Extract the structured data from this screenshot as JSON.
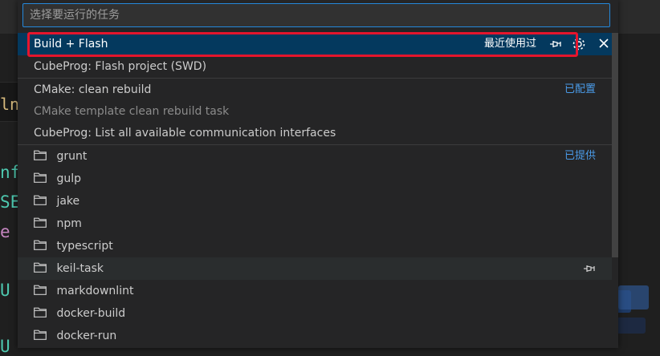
{
  "quick_pick": {
    "placeholder": "选择要运行的任务",
    "items": [
      {
        "label": "Build + Flash",
        "recent_label": "最近使用过"
      },
      {
        "label": "CubeProg: Flash project (SWD)"
      },
      {
        "label": "CMake: clean rebuild",
        "group_label": "已配置"
      },
      {
        "label": "CMake template clean rebuild task"
      },
      {
        "label": "CubeProg: List all available communication interfaces"
      },
      {
        "label": "grunt",
        "group_label": "已提供"
      },
      {
        "label": "gulp"
      },
      {
        "label": "jake"
      },
      {
        "label": "npm"
      },
      {
        "label": "typescript"
      },
      {
        "label": "keil-task"
      },
      {
        "label": "markdownlint"
      },
      {
        "label": "docker-build"
      },
      {
        "label": "docker-run"
      }
    ],
    "icons": {
      "pin": "pin-icon",
      "settings": "gear-icon",
      "close": "close-icon",
      "folder": "folder-icon"
    },
    "colors": {
      "active_bg": "#04395e",
      "highlight_border": "#e5152d",
      "group_label": "#4a9be8",
      "input_border": "#2488db"
    }
  },
  "editor_fragments": {
    "frag1": "ln",
    "frag2": "nf",
    "frag3": "SE",
    "frag4": "e",
    "frag5": "U",
    "frag6": "U"
  }
}
